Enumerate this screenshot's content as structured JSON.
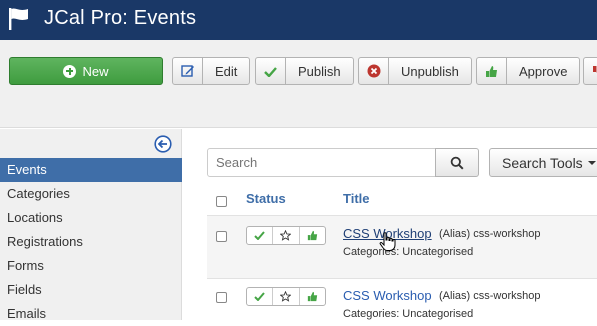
{
  "header": {
    "title": "JCal Pro: Events"
  },
  "toolbar": {
    "new_label": "New",
    "edit_label": "Edit",
    "publish_label": "Publish",
    "unpublish_label": "Unpublish",
    "approve_label": "Approve"
  },
  "sidebar": {
    "items": [
      {
        "label": "Events"
      },
      {
        "label": "Categories"
      },
      {
        "label": "Locations"
      },
      {
        "label": "Registrations"
      },
      {
        "label": "Forms"
      },
      {
        "label": "Fields"
      },
      {
        "label": "Emails"
      }
    ]
  },
  "search": {
    "placeholder": "Search",
    "tools_label": "Search Tools"
  },
  "table": {
    "headers": {
      "status": "Status",
      "title": "Title"
    },
    "rows": [
      {
        "title": "CSS Workshop",
        "alias": "(Alias) css-workshop",
        "category": "Categories: Uncategorised"
      },
      {
        "title": "CSS Workshop",
        "alias": "(Alias) css-workshop",
        "category": "Categories: Uncategorised"
      }
    ]
  },
  "colors": {
    "header_bg": "#1a3867",
    "accent": "#3f6ea8",
    "new_button": "#46a546"
  }
}
